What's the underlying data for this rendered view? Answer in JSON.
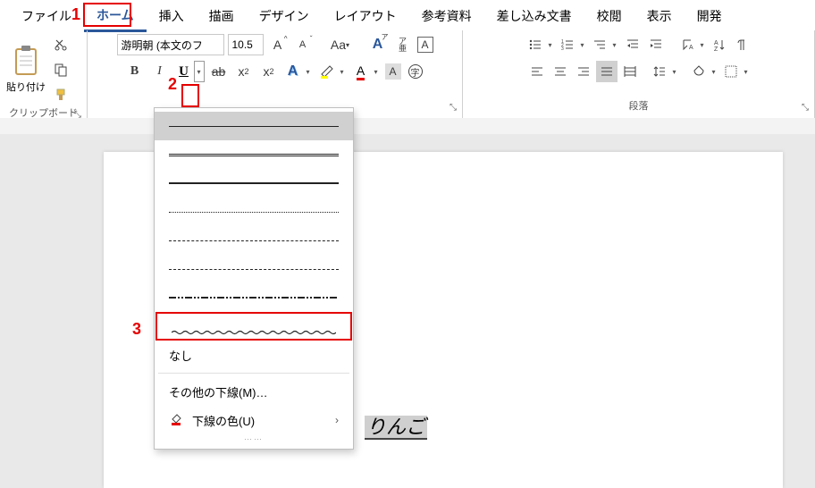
{
  "callouts": {
    "c1": "1",
    "c2": "2",
    "c3": "3"
  },
  "tabs": {
    "file": "ファイル",
    "home": "ホーム",
    "insert": "挿入",
    "draw": "描画",
    "design": "デザイン",
    "layout": "レイアウト",
    "references": "参考資料",
    "mailings": "差し込み文書",
    "review": "校閲",
    "view": "表示",
    "developer": "開発"
  },
  "clipboard": {
    "label": "クリップボード",
    "paste": "貼り付け"
  },
  "font": {
    "name": "游明朝 (本文のフ",
    "size": "10.5"
  },
  "paragraph": {
    "label": "段落"
  },
  "underline_menu": {
    "none": "なし",
    "more": "その他の下線(M)…",
    "color": "下線の色(U)"
  },
  "document": {
    "text": "りんご"
  }
}
